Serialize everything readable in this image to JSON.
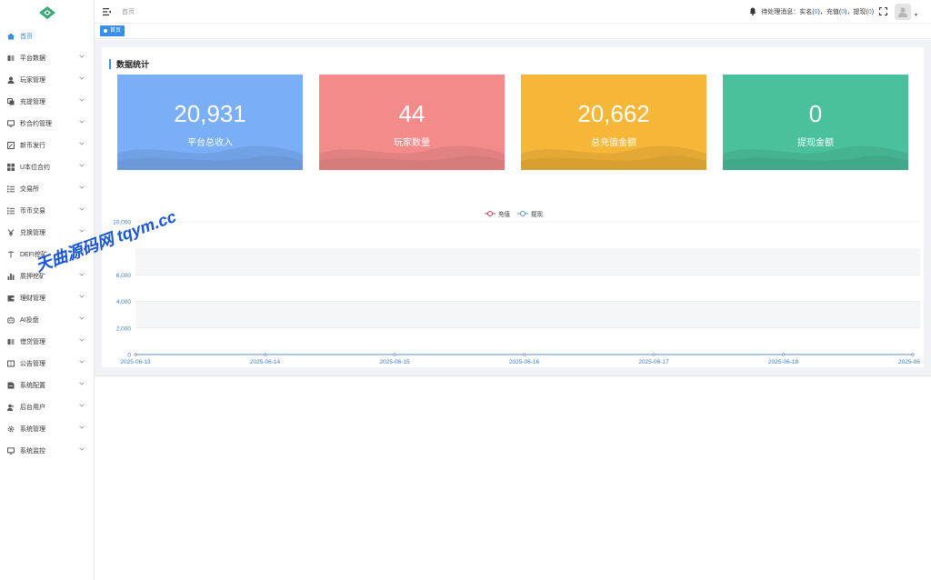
{
  "sidebar": {
    "items": [
      {
        "label": "首页",
        "icon": "home-icon",
        "active": true,
        "chevron": false
      },
      {
        "label": "平台数据",
        "icon": "book-icon",
        "active": false,
        "chevron": true
      },
      {
        "label": "玩家管理",
        "icon": "user-icon",
        "active": false,
        "chevron": true
      },
      {
        "label": "充提管理",
        "icon": "copy-icon",
        "active": false,
        "chevron": true
      },
      {
        "label": "秒合约管理",
        "icon": "monitor-icon",
        "active": false,
        "chevron": true
      },
      {
        "label": "新币发行",
        "icon": "edit-icon",
        "active": false,
        "chevron": true
      },
      {
        "label": "U本位合约",
        "icon": "grid-icon",
        "active": false,
        "chevron": true
      },
      {
        "label": "交易所",
        "icon": "list-icon",
        "active": false,
        "chevron": true
      },
      {
        "label": "币币交易",
        "icon": "list-icon",
        "active": false,
        "chevron": true
      },
      {
        "label": "兑换管理",
        "icon": "yen-icon",
        "active": false,
        "chevron": true
      },
      {
        "label": "DEFI挖矿",
        "icon": "pickaxe-icon",
        "active": false,
        "chevron": true
      },
      {
        "label": "质押挖矿",
        "icon": "chart-bar-icon",
        "active": false,
        "chevron": true
      },
      {
        "label": "理财管理",
        "icon": "wallet-icon",
        "active": false,
        "chevron": true
      },
      {
        "label": "AI投盘",
        "icon": "robot-icon",
        "active": false,
        "chevron": true
      },
      {
        "label": "借贷管理",
        "icon": "book-icon",
        "active": false,
        "chevron": true
      },
      {
        "label": "公告管理",
        "icon": "notice-icon",
        "active": false,
        "chevron": true
      },
      {
        "label": "系统配置",
        "icon": "config-icon",
        "active": false,
        "chevron": true
      },
      {
        "label": "后台用户",
        "icon": "users-icon",
        "active": false,
        "chevron": true
      },
      {
        "label": "系统管理",
        "icon": "gear-icon",
        "active": false,
        "chevron": true
      },
      {
        "label": "系统监控",
        "icon": "monitor-icon",
        "active": false,
        "chevron": true
      }
    ]
  },
  "header": {
    "breadcrumb": "首页",
    "notice_prefix": "待处理消息：实名(",
    "realname_count": "0",
    "mid1": ")，充值(",
    "recharge_count": "0",
    "mid2": ")，提现(",
    "withdraw_count": "0",
    "suffix": ")"
  },
  "tags": {
    "active_tag": "首页"
  },
  "panel": {
    "title": "数据统计"
  },
  "cards": [
    {
      "value": "20,931",
      "label": "平台总收入",
      "color": "#7aaef7"
    },
    {
      "value": "44",
      "label": "玩家数量",
      "color": "#f48b8b"
    },
    {
      "value": "20,662",
      "label": "总充值金额",
      "color": "#f6b638"
    },
    {
      "value": "0",
      "label": "提现金额",
      "color": "#4bc09c"
    }
  ],
  "chart_data": {
    "type": "line",
    "x": [
      "2025-06-13",
      "2025-06-14",
      "2025-06-15",
      "2025-06-16",
      "2025-06-17",
      "2025-06-18",
      "2025-06"
    ],
    "series": [
      {
        "name": "充值",
        "values": [
          0,
          0,
          0,
          0,
          0,
          0,
          0
        ],
        "color": "#c23c54"
      },
      {
        "name": "提现",
        "values": [
          0,
          0,
          0,
          0,
          0,
          0,
          0
        ],
        "color": "#5b8fc9"
      }
    ],
    "yticks": [
      "0",
      "2,000",
      "4,000",
      "6,000",
      "10,000"
    ],
    "ylim": [
      0,
      10000
    ],
    "legend": "top-center",
    "grid": true
  },
  "watermark": "天曲源码网 tqym.cc"
}
